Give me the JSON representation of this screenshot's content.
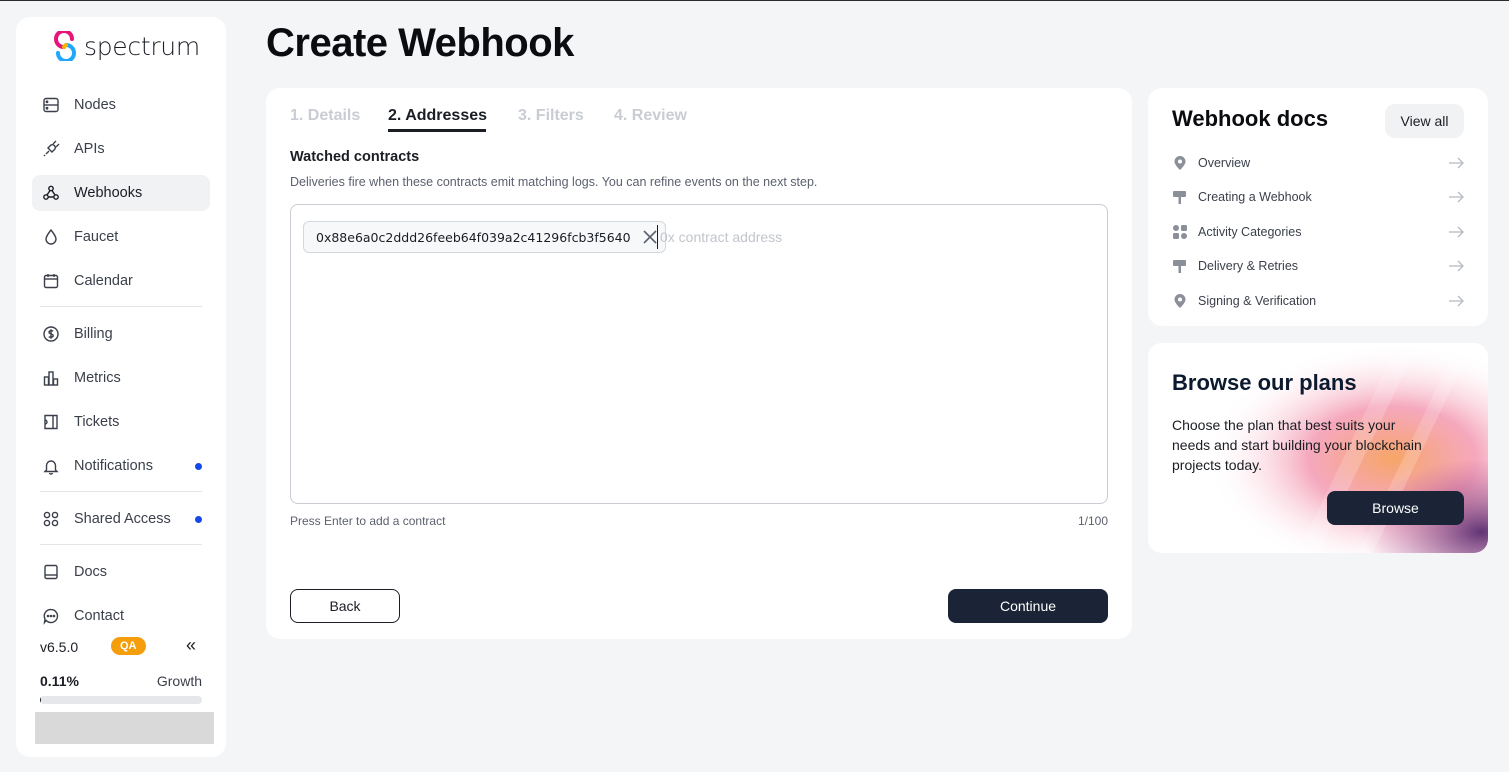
{
  "brand": {
    "name": "spectrum"
  },
  "sidebar": {
    "items": [
      {
        "label": "Nodes",
        "icon": "server-icon"
      },
      {
        "label": "APIs",
        "icon": "plug-icon"
      },
      {
        "label": "Webhooks",
        "icon": "webhook-icon",
        "active": true
      },
      {
        "label": "Faucet",
        "icon": "droplet-icon"
      },
      {
        "label": "Calendar",
        "icon": "calendar-icon"
      },
      {
        "label": "Billing",
        "icon": "dollar-icon"
      },
      {
        "label": "Metrics",
        "icon": "bar-chart-icon"
      },
      {
        "label": "Tickets",
        "icon": "ticket-icon"
      },
      {
        "label": "Notifications",
        "icon": "bell-icon",
        "has_dot": true
      },
      {
        "label": "Shared Access",
        "icon": "grid-icon",
        "has_dot": true
      },
      {
        "label": "Docs",
        "icon": "book-icon"
      },
      {
        "label": "Contact",
        "icon": "chat-icon"
      }
    ],
    "version": "v6.5.0",
    "env_badge": "QA",
    "collapse_glyph": "«",
    "usage": {
      "percent_label": "0.11%",
      "plan": "Growth",
      "fraction": 0.0011
    }
  },
  "page": {
    "title": "Create Webhook"
  },
  "wizard": {
    "tabs": [
      {
        "label": "1. Details"
      },
      {
        "label": "2. Addresses",
        "active": true
      },
      {
        "label": "3. Filters"
      },
      {
        "label": "4. Review"
      }
    ],
    "section_title": "Watched contracts",
    "section_desc": "Deliveries fire when these contracts emit matching logs. You can refine events on the next step.",
    "contracts": [
      "0x88e6a0c2ddd26feeb64f039a2c41296fcb3f5640"
    ],
    "input_placeholder": "0x contract address",
    "hint": "Press Enter to add a contract",
    "counter": "1/100",
    "back_label": "Back",
    "continue_label": "Continue"
  },
  "docs": {
    "title": "Webhook docs",
    "view_all_label": "View all",
    "links": [
      {
        "label": "Overview",
        "icon": "map-pin-icon"
      },
      {
        "label": "Creating a Webhook",
        "icon": "signpost-icon"
      },
      {
        "label": "Activity Categories",
        "icon": "shapes-icon"
      },
      {
        "label": "Delivery & Retries",
        "icon": "signpost-icon"
      },
      {
        "label": "Signing & Verification",
        "icon": "map-pin-icon"
      }
    ]
  },
  "plans": {
    "title": "Browse our plans",
    "description": "Choose the plan that best suits your needs and start building your blockchain projects today.",
    "button_label": "Browse"
  },
  "colors": {
    "accent_dark": "#1a2436",
    "notification_dot": "#1548e8",
    "qa_badge": "#f59e0b"
  }
}
